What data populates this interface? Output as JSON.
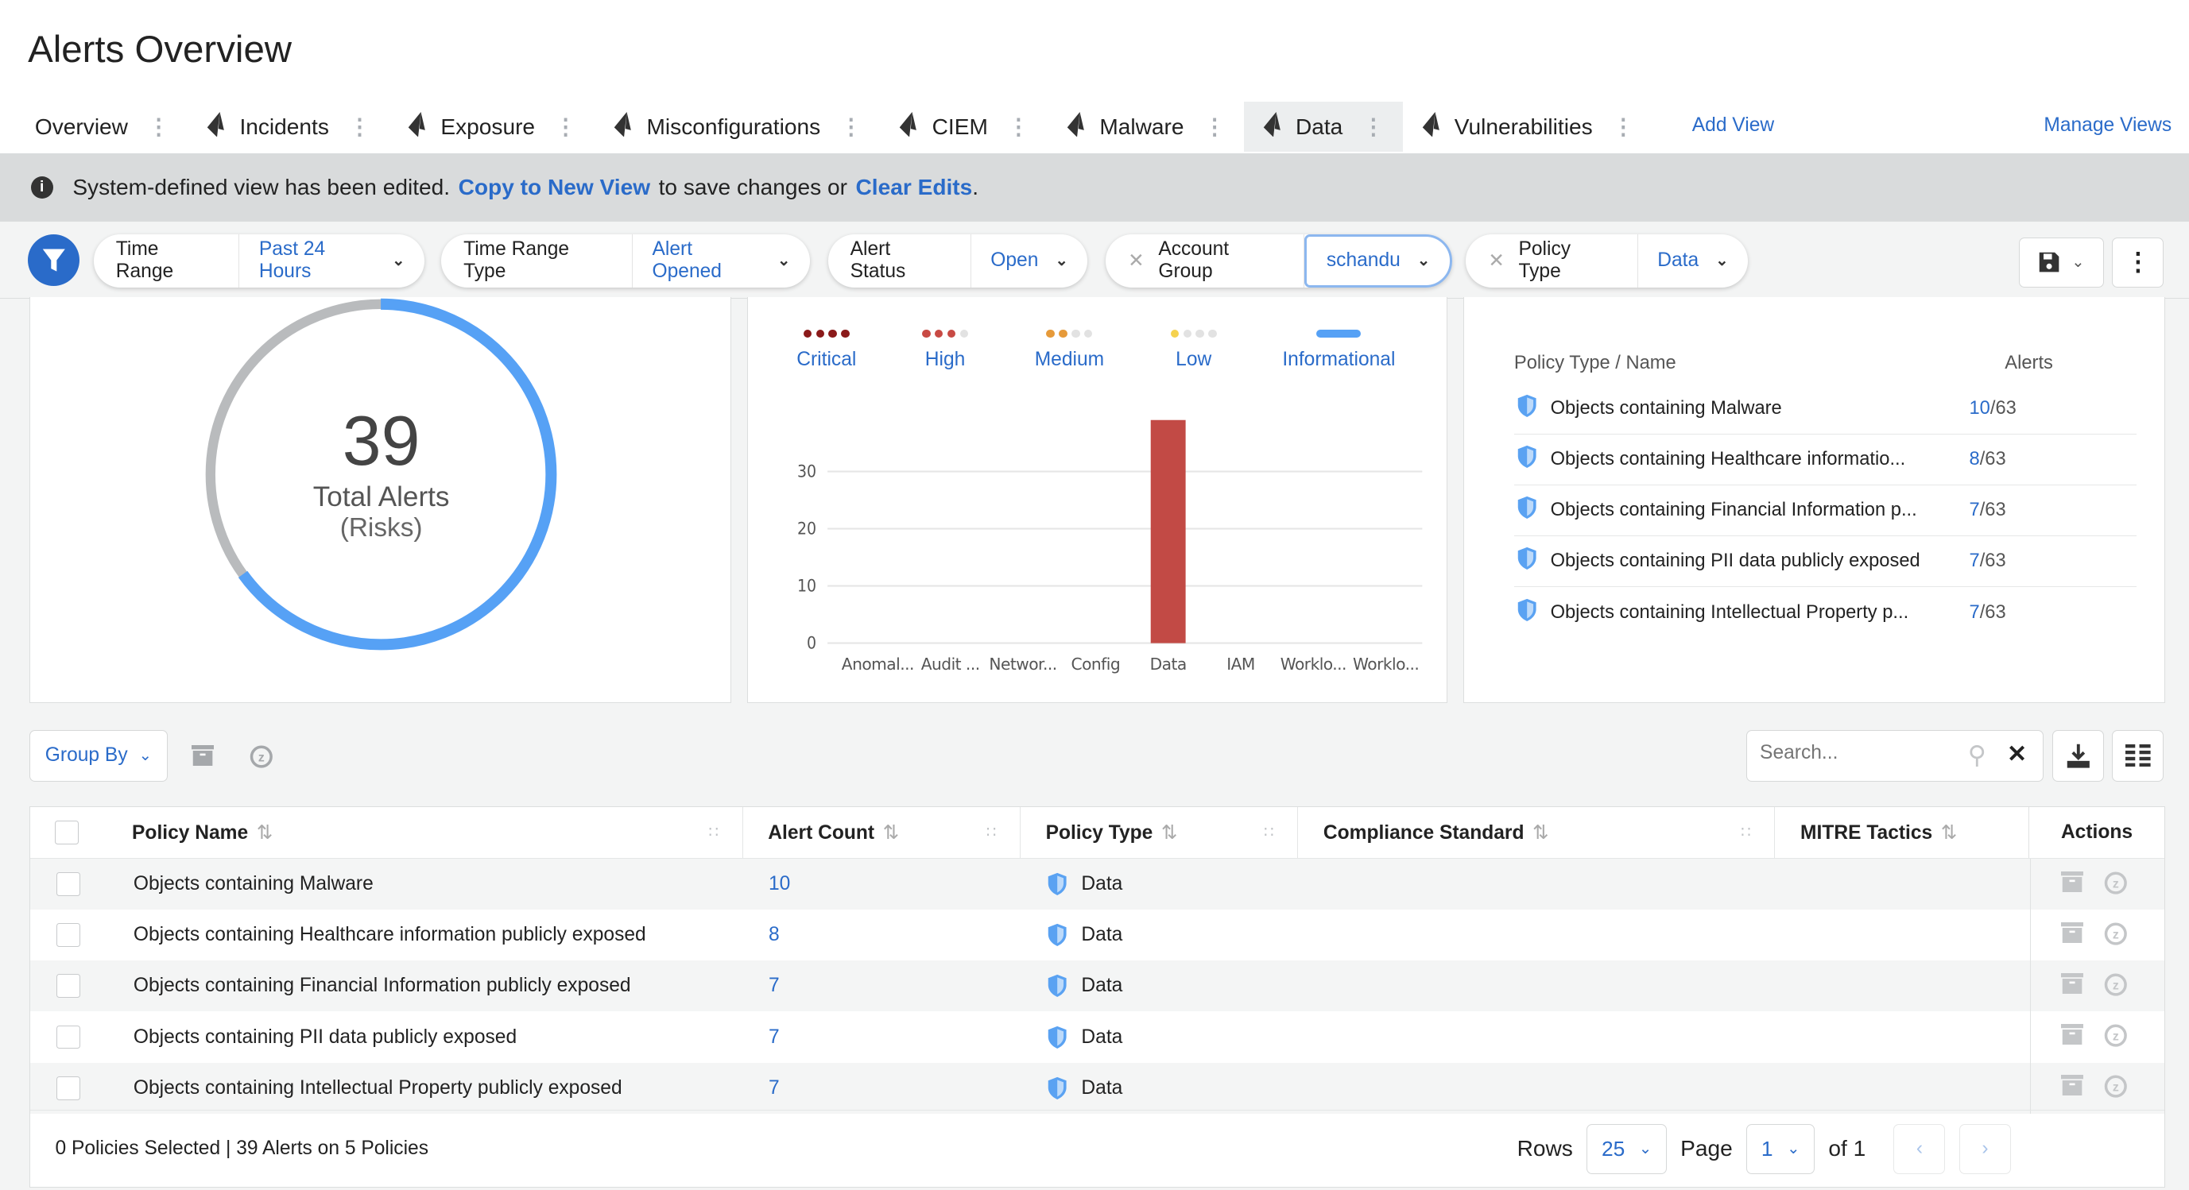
{
  "page_title": "Alerts Overview",
  "tabs": [
    {
      "label": "Overview",
      "icon": null
    },
    {
      "label": "Incidents",
      "icon": "prisma-icon"
    },
    {
      "label": "Exposure",
      "icon": "prisma-icon"
    },
    {
      "label": "Misconfigurations",
      "icon": "prisma-icon"
    },
    {
      "label": "CIEM",
      "icon": "prisma-icon"
    },
    {
      "label": "Malware",
      "icon": "prisma-icon"
    },
    {
      "label": "Data",
      "icon": "prisma-icon",
      "active": true
    },
    {
      "label": "Vulnerabilities",
      "icon": "prisma-icon"
    }
  ],
  "add_view": "Add View",
  "manage_views": "Manage Views",
  "banner": {
    "text1": "System-defined view has been edited.",
    "link1": "Copy to New View",
    "text2": "to save changes or",
    "link2": "Clear Edits",
    "text3": "."
  },
  "filters": [
    {
      "key": "Time Range",
      "value": "Past 24 Hours",
      "removable": false
    },
    {
      "key": "Time Range Type",
      "value": "Alert Opened",
      "removable": false
    },
    {
      "key": "Alert Status",
      "value": "Open",
      "removable": false
    },
    {
      "key": "Account Group",
      "value": "schandu",
      "removable": true
    },
    {
      "key": "Policy Type",
      "value": "Data",
      "removable": true
    }
  ],
  "donut": {
    "value": "39",
    "label": "Total Alerts",
    "sublabel": "(Risks)",
    "blue_fraction": 0.65,
    "colors": {
      "main": "#56a1f5",
      "rest": "#b9bbbd"
    }
  },
  "severity_legend": [
    {
      "label": "Critical",
      "filled": 4,
      "color": "#8b1a1a"
    },
    {
      "label": "High",
      "filled": 3,
      "color": "#c84a44"
    },
    {
      "label": "Medium",
      "filled": 2,
      "color": "#e69a3a"
    },
    {
      "label": "Low",
      "filled": 1,
      "color": "#f5d24f"
    },
    {
      "label": "Informational",
      "filled": 0,
      "color": "#56a1f5"
    }
  ],
  "chart_data": {
    "type": "bar",
    "categories": [
      "Anomal...",
      "Audit ...",
      "Networ...",
      "Config",
      "Data",
      "IAM",
      "Worklo...",
      "Worklo..."
    ],
    "values": [
      0,
      0,
      0,
      0,
      39,
      0,
      0,
      0
    ],
    "yticks": [
      "0",
      "10",
      "20",
      "30"
    ],
    "ylim": [
      0,
      40
    ],
    "grid": true,
    "bar_color": "#c24a45"
  },
  "policy_summary": {
    "col_name": "Policy Type / Name",
    "col_alerts": "Alerts",
    "rows": [
      {
        "name": "Objects containing Malware",
        "count": "10",
        "total": "/63"
      },
      {
        "name": "Objects containing Healthcare informatio...",
        "count": "8",
        "total": "/63"
      },
      {
        "name": "Objects containing Financial Information p...",
        "count": "7",
        "total": "/63"
      },
      {
        "name": "Objects containing PII data publicly exposed",
        "count": "7",
        "total": "/63"
      },
      {
        "name": "Objects containing Intellectual Property p...",
        "count": "7",
        "total": "/63"
      }
    ]
  },
  "toolbar": {
    "group_by": "Group By",
    "search_placeholder": "Search..."
  },
  "table": {
    "columns": [
      "Policy Name",
      "Alert Count",
      "Policy Type",
      "Compliance Standard",
      "MITRE Tactics",
      "Actions"
    ],
    "rows": [
      {
        "name": "Objects containing Malware",
        "count": "10",
        "type": "Data"
      },
      {
        "name": "Objects containing Healthcare information publicly exposed",
        "count": "8",
        "type": "Data"
      },
      {
        "name": "Objects containing Financial Information publicly exposed",
        "count": "7",
        "type": "Data"
      },
      {
        "name": "Objects containing PII data publicly exposed",
        "count": "7",
        "type": "Data"
      },
      {
        "name": "Objects containing Intellectual Property publicly exposed",
        "count": "7",
        "type": "Data"
      }
    ]
  },
  "footer": {
    "summary": "0 Policies Selected | 39 Alerts on 5 Policies",
    "rows_label": "Rows",
    "rows_value": "25",
    "page_label": "Page",
    "page_value": "1",
    "of_label": "of 1"
  },
  "colors": {
    "accent": "#2a6bc9"
  }
}
